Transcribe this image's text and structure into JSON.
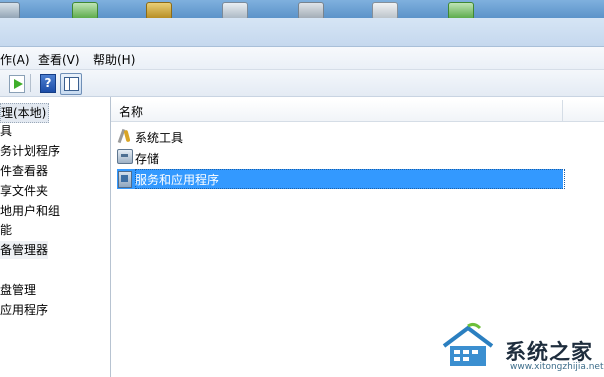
{
  "menubar": {
    "items": [
      {
        "label": "作(A)"
      },
      {
        "label": "查看(V)"
      },
      {
        "label": "帮助(H)"
      }
    ]
  },
  "toolbar": {
    "buttons": [
      {
        "icon": "export-list-icon"
      },
      {
        "icon": "help-icon",
        "label": "?"
      },
      {
        "icon": "show-hide-tree-icon"
      }
    ]
  },
  "tree": {
    "items": [
      {
        "label": "理(本地)"
      },
      {
        "label": "具"
      },
      {
        "label": "务计划程序"
      },
      {
        "label": "件查看器"
      },
      {
        "label": "享文件夹"
      },
      {
        "label": "地用户和组"
      },
      {
        "label": "能"
      },
      {
        "label": "备管理器"
      },
      {
        "label": ""
      },
      {
        "label": "盘管理"
      },
      {
        "label": "应用程序"
      }
    ]
  },
  "list": {
    "column_header": "名称",
    "rows": [
      {
        "label": "系统工具",
        "icon": "tools-icon"
      },
      {
        "label": "存储",
        "icon": "storage-icon"
      },
      {
        "label": "服务和应用程序",
        "icon": "services-icon",
        "selected": true
      }
    ]
  },
  "watermark": {
    "text": "系统之家",
    "url": "www.xitongzhijia.net"
  },
  "colors": {
    "selection": "#3399ff",
    "taskbar": "#6fa3d6"
  }
}
